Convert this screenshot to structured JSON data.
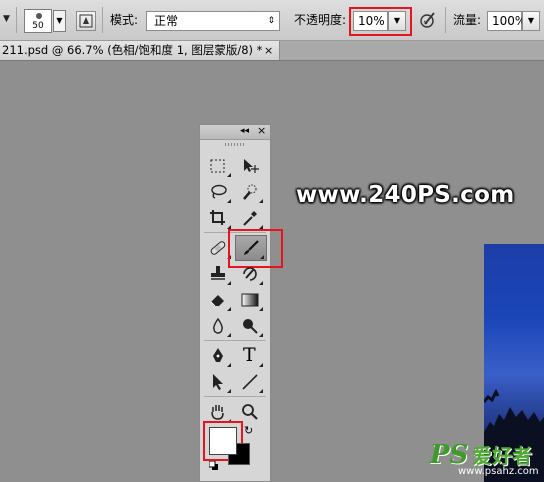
{
  "options_bar": {
    "brush_size": "50",
    "mode_label": "模式:",
    "mode_value": "正常",
    "opacity_label": "不透明度:",
    "opacity_value": "10%",
    "flow_label": "流量:",
    "flow_value": "100%"
  },
  "document_tab": {
    "title": "211.psd @ 66.7% (色相/饱和度 1, 图层蒙版/8) *",
    "close": "×"
  },
  "toolbox": {
    "collapse": "◂◂",
    "close": "×",
    "active_tool": "brush-tool",
    "type_tool_glyph": "T"
  },
  "watermark": {
    "text": "www.240PS.com"
  },
  "logo": {
    "ps": "PS",
    "cn": "爱好者",
    "url": "www.psahz.com"
  },
  "colors": {
    "highlight_red": "#e8131f",
    "foreground_color": "#ffffff",
    "background_color": "#000000"
  }
}
